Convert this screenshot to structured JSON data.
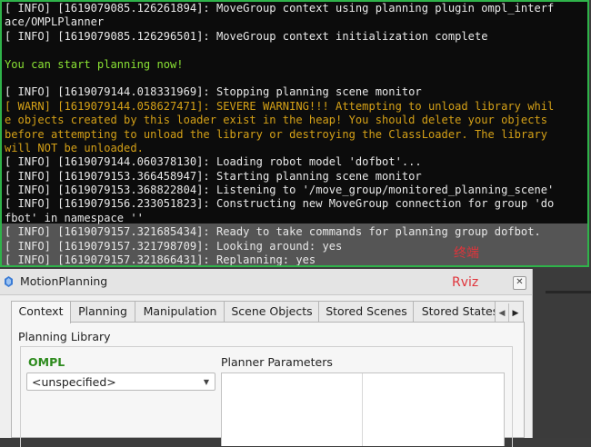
{
  "terminal": {
    "lines": [
      {
        "text": "[ INFO] [1619079085.126261894]: MoveGroup context using planning plugin ompl_interf",
        "style": "normal"
      },
      {
        "text": "ace/OMPLPlanner",
        "style": "normal"
      },
      {
        "text": "[ INFO] [1619079085.126296501]: MoveGroup context initialization complete",
        "style": "normal"
      },
      {
        "text": "",
        "style": "normal"
      },
      {
        "text": "You can start planning now!",
        "style": "ok"
      },
      {
        "text": "",
        "style": "normal"
      },
      {
        "text": "[ INFO] [1619079144.018331969]: Stopping planning scene monitor",
        "style": "normal"
      },
      {
        "text": "[ WARN] [1619079144.058627471]: SEVERE WARNING!!! Attempting to unload library whil",
        "style": "warn"
      },
      {
        "text": "e objects created by this loader exist in the heap! You should delete your objects",
        "style": "warn"
      },
      {
        "text": "before attempting to unload the library or destroying the ClassLoader. The library",
        "style": "warn"
      },
      {
        "text": "will NOT be unloaded.",
        "style": "warn"
      },
      {
        "text": "[ INFO] [1619079144.060378130]: Loading robot model 'dofbot'...",
        "style": "normal"
      },
      {
        "text": "[ INFO] [1619079153.366458947]: Starting planning scene monitor",
        "style": "normal"
      },
      {
        "text": "[ INFO] [1619079153.368822804]: Listening to '/move_group/monitored_planning_scene'",
        "style": "normal"
      },
      {
        "text": "[ INFO] [1619079156.233051823]: Constructing new MoveGroup connection for group 'do",
        "style": "normal"
      },
      {
        "text": "fbot' in namespace ''",
        "style": "normal"
      },
      {
        "text": "[ INFO] [1619079157.321685434]: Ready to take commands for planning group dofbot.",
        "style": "normal"
      },
      {
        "text": "[ INFO] [1619079157.321798709]: Looking around: yes",
        "style": "normal"
      },
      {
        "text": "[ INFO] [1619079157.321866431]: Replanning: yes",
        "style": "normal"
      }
    ],
    "annotation": "终端",
    "colors": {
      "border": "#2fb34a",
      "ok": "#8ae234",
      "warn": "#d4a017",
      "annotation": "#e0343b"
    }
  },
  "panel": {
    "title": "MotionPlanning",
    "annotation": "Rviz",
    "close_icon": "close-icon",
    "title_icon": "motion-planning-icon",
    "tabs": [
      {
        "label": "Context",
        "active": true
      },
      {
        "label": "Planning",
        "active": false
      },
      {
        "label": "Manipulation",
        "active": false
      },
      {
        "label": "Scene Objects",
        "active": false
      },
      {
        "label": "Stored Scenes",
        "active": false
      },
      {
        "label": "Stored States",
        "active": false
      }
    ],
    "planning_library_label": "Planning Library",
    "ompl_label": "OMPL",
    "planner_parameters_label": "Planner Parameters",
    "planner_select_value": "<unspecified>",
    "colors": {
      "ompl": "#2e8b1e"
    }
  }
}
